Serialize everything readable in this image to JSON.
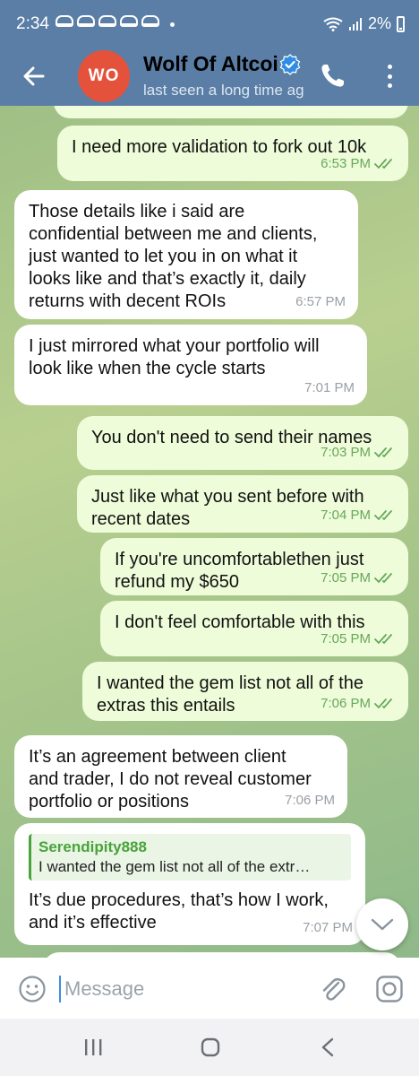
{
  "status_bar": {
    "time": "2:34",
    "battery": "2%"
  },
  "header": {
    "avatar_initials": "WO",
    "contact_name": "Wolf Of Altcoins",
    "last_seen": "last seen a long time ago",
    "icons": [
      "back-arrow-icon",
      "verified-badge-icon",
      "phone-icon",
      "more-vert-icon"
    ]
  },
  "messages": [
    {
      "direction": "out",
      "text": "I need more validation to fork out 10k",
      "time": "6:53 PM"
    },
    {
      "direction": "in",
      "text": "Those details like i said are\nconfidential between me and clients,\njust wanted to let you in on what it\nlooks like and that’s exactly it, daily\nreturns with decent ROIs",
      "time": "6:57 PM"
    },
    {
      "direction": "in",
      "text": "I just mirrored what your portfolio will\nlook like when the cycle starts",
      "time": "7:01 PM"
    },
    {
      "direction": "out",
      "text": "You don't need to send their names",
      "time": "7:03 PM"
    },
    {
      "direction": "out",
      "text": "Just like what you sent before with\nrecent dates",
      "time": "7:04 PM"
    },
    {
      "direction": "out",
      "text": "If you're uncomfortablethen just\nrefund my $650",
      "time": "7:05 PM"
    },
    {
      "direction": "out",
      "text": "I don't feel comfortable with this",
      "time": "7:05 PM"
    },
    {
      "direction": "out",
      "text": "I wanted the gem list not all of the\nextras this entails",
      "time": "7:06 PM"
    },
    {
      "direction": "in",
      "text": "It’s an agreement between client\nand trader, I do not reveal customer\nportfolio or positions",
      "time": "7:06 PM"
    },
    {
      "direction": "in",
      "reply_name": "Serendipity888",
      "reply_text": "I wanted the gem list not all of the extr…",
      "text": "It’s due procedures, that’s how I work,\nand it’s effective",
      "time": "7:07 PM"
    }
  ],
  "input": {
    "placeholder": "Message"
  },
  "colors": {
    "header": "#5a7ea6",
    "outgoing_bubble": "#eefcd9",
    "incoming_bubble": "#ffffff",
    "avatar": "#e4523b",
    "accent": "#48a33a"
  }
}
